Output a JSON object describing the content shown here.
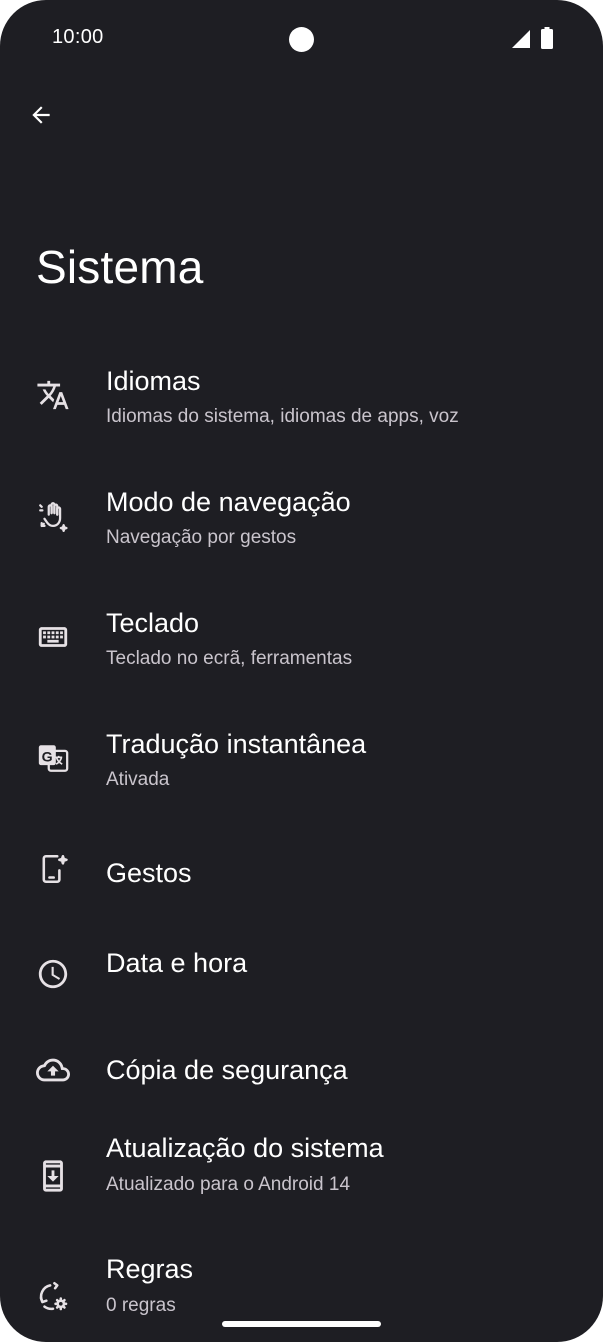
{
  "status_bar": {
    "time": "10:00"
  },
  "header": {
    "back_icon": "arrow-back-icon",
    "title": "Sistema"
  },
  "settings": [
    {
      "name": "idiomas",
      "icon": "translate-icon",
      "label": "Idiomas",
      "sub": "Idiomas do sistema, idiomas de apps, voz"
    },
    {
      "name": "modo-de-navegacao",
      "icon": "gesture-hand-icon",
      "label": "Modo de navegação",
      "sub": "Navegação por gestos"
    },
    {
      "name": "teclado",
      "icon": "keyboard-icon",
      "label": "Teclado",
      "sub": "Teclado no ecrã, ferramentas"
    },
    {
      "name": "traducao-instantanea",
      "icon": "google-translate-icon",
      "label": "Tradução instantânea",
      "sub": "Ativada"
    },
    {
      "name": "gestos",
      "icon": "phone-gesture-icon",
      "label": "Gestos",
      "sub": ""
    },
    {
      "name": "data-e-hora",
      "icon": "clock-icon",
      "label": "Data e hora",
      "sub": ""
    },
    {
      "name": "copia-de-seguranca",
      "icon": "cloud-upload-icon",
      "label": "Cópia de segurança",
      "sub": ""
    },
    {
      "name": "atualizacao-do-sistema",
      "icon": "system-update-icon",
      "label": "Atualização do sistema",
      "sub": "Atualizado para o Android 14"
    },
    {
      "name": "regras",
      "icon": "rules-sync-icon",
      "label": "Regras",
      "sub": "0 regras"
    }
  ],
  "colors": {
    "background": "#1e1e23",
    "primary_text": "#ffffff",
    "secondary_text": "#c9c4cc"
  }
}
